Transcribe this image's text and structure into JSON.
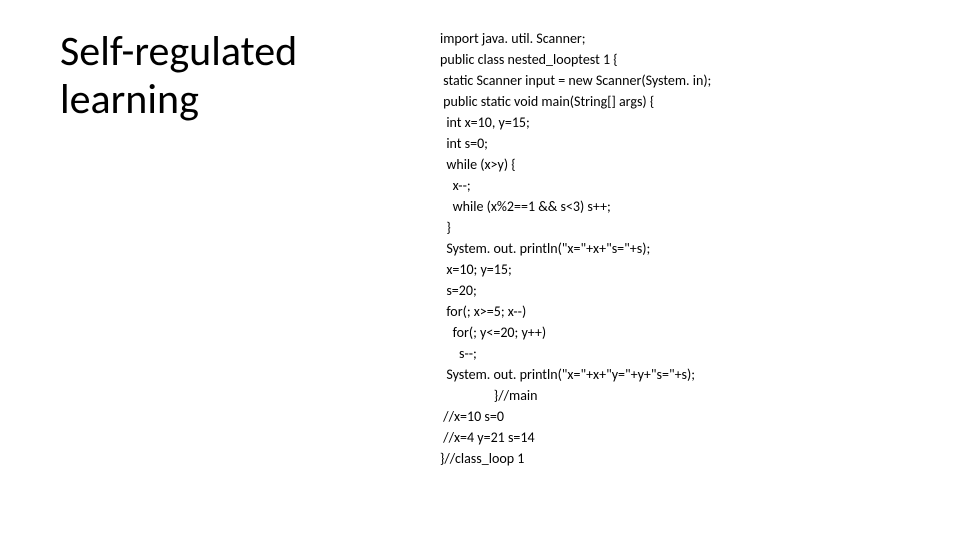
{
  "slide": {
    "title": "Self-regulated learning",
    "code_lines": [
      "import java. util. Scanner;",
      "public class nested_looptest 1 {",
      " static Scanner input = new Scanner(System. in);",
      " public static void main(String[] args) {",
      "  int x=10, y=15;",
      "  int s=0;",
      "  while (x>y) {",
      "    x--;",
      "    while (x%2==1 && s<3) s++;",
      "  }",
      "  System. out. println(\"x=\"+x+\"s=\"+s);",
      "  x=10; y=15;",
      "  s=20;",
      "  for(; x>=5; x--)",
      "    for(; y<=20; y++)",
      "      s--;",
      "  System. out. println(\"x=\"+x+\"y=\"+y+\"s=\"+s);",
      "                 }//main",
      " //x=10 s=0",
      " //x=4 y=21 s=14",
      "}//class_loop 1"
    ]
  }
}
